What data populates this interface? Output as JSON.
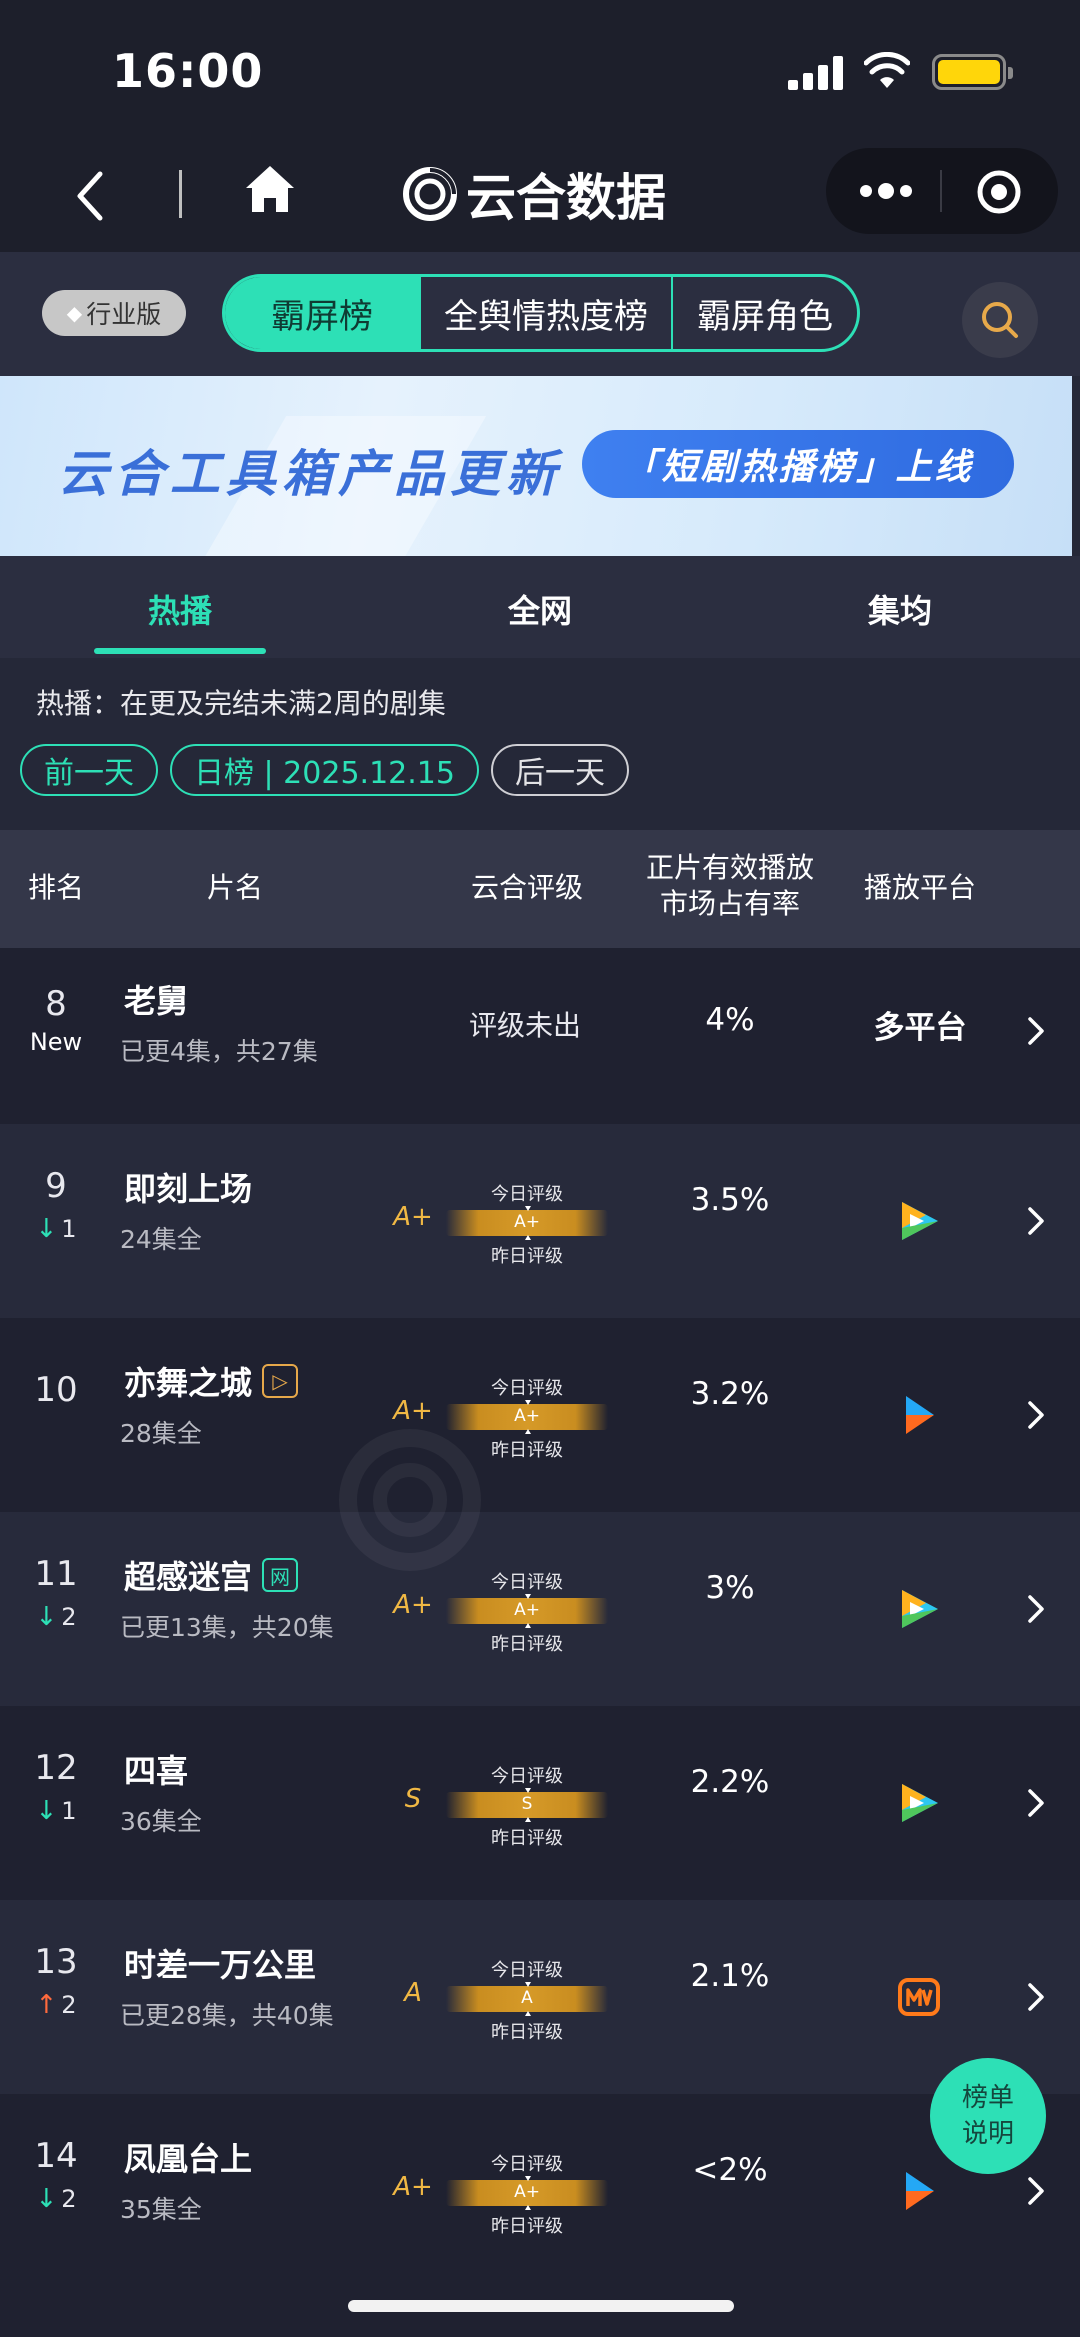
{
  "status": {
    "time": "16:00"
  },
  "nav": {
    "title": "云合数据"
  },
  "segments": {
    "edition": "行业版",
    "items": [
      "霸屏榜",
      "全舆情热度榜",
      "霸屏角色"
    ],
    "active": 0
  },
  "banner": {
    "headline": "云合工具箱产品更新",
    "pill": "「短剧热播榜」上线"
  },
  "tabs": {
    "items": [
      "热播",
      "全网",
      "集均"
    ],
    "active": 0
  },
  "info": {
    "description": "热播：在更及完结未满2周的剧集",
    "prev_day": "前一天",
    "current": "日榜 | 2025.12.15",
    "next_day": "后一天"
  },
  "table": {
    "headers": {
      "rank": "排名",
      "title": "片名",
      "grade": "云合评级",
      "share_line1": "正片有效播放",
      "share_line2": "市场占有率",
      "platform": "播放平台"
    },
    "grade_today": "今日评级",
    "grade_yesterday": "昨日评级",
    "rows": [
      {
        "rank": "8",
        "change": "New",
        "title": "老舅",
        "subtitle": "已更4集，共27集",
        "grade_text": "评级未出",
        "share": "4%",
        "platform": "多平台"
      },
      {
        "rank": "9",
        "change": "1",
        "dir": "down",
        "title": "即刻上场",
        "subtitle": "24集全",
        "grade": "A+",
        "share": "3.5%",
        "platform_icon": "tencent-video-icon"
      },
      {
        "rank": "10",
        "change": "",
        "title": "亦舞之城",
        "tag": "play",
        "subtitle": "28集全",
        "grade": "A+",
        "share": "3.2%",
        "platform_icon": "youku-icon"
      },
      {
        "rank": "11",
        "change": "2",
        "dir": "down",
        "title": "超感迷宫",
        "tag": "net",
        "tag_text": "网",
        "subtitle": "已更13集，共20集",
        "grade": "A+",
        "share": "3%",
        "platform_icon": "tencent-video-icon"
      },
      {
        "rank": "12",
        "change": "1",
        "dir": "down",
        "title": "四喜",
        "subtitle": "36集全",
        "grade": "S",
        "share": "2.2%",
        "platform_icon": "tencent-video-icon"
      },
      {
        "rank": "13",
        "change": "2",
        "dir": "up",
        "title": "时差一万公里",
        "subtitle": "已更28集，共40集",
        "grade": "A",
        "share": "2.1%",
        "platform_icon": "mango-tv-icon"
      },
      {
        "rank": "14",
        "change": "2",
        "dir": "down",
        "title": "凤凰台上",
        "subtitle": "35集全",
        "grade": "A+",
        "share": "<2%",
        "platform_icon": "youku-icon"
      }
    ]
  },
  "float_button": {
    "line1": "榜单",
    "line2": "说明"
  },
  "colors": {
    "accent": "#2de0b6",
    "grade": "#f0b844",
    "up": "#ff6a3d"
  }
}
